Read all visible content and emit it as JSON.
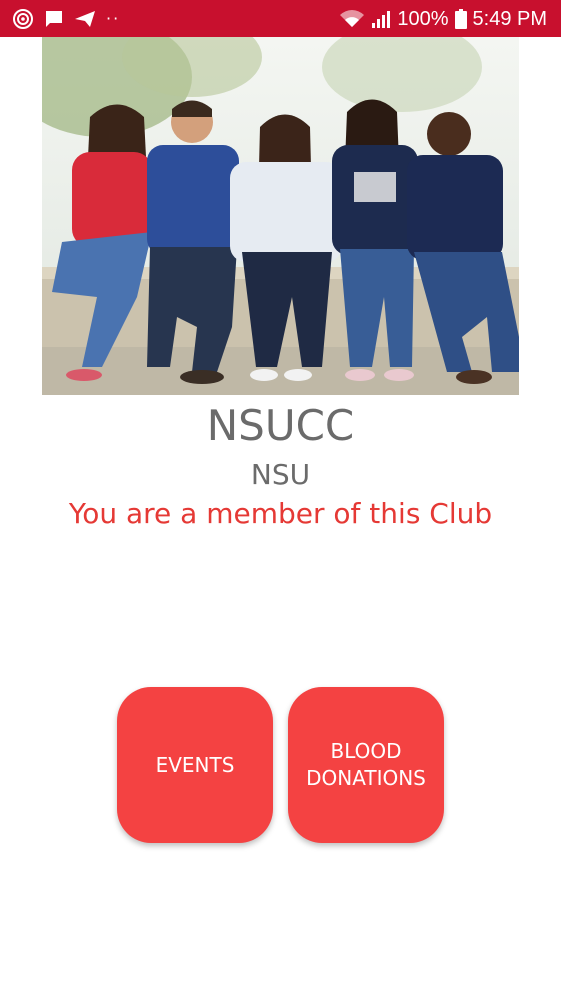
{
  "status_bar": {
    "battery": "100%",
    "time": "5:49 PM",
    "background": "#c8102e",
    "icons": [
      "app-swirl-icon",
      "message-icon",
      "send-icon",
      "more-dots-icon",
      "wifi-icon",
      "signal-icon",
      "battery-icon"
    ]
  },
  "hero": {
    "image": "group-of-young-people-sitting-on-wall"
  },
  "club": {
    "name": "NSUCC",
    "organization": "NSU",
    "membership_status": "You are a member of this Club"
  },
  "actions": {
    "events_label": "EVENTS",
    "blood_donations_label": "BLOOD\nDONATIONS",
    "button_color": "#f44242"
  },
  "colors": {
    "accent_red": "#e53935",
    "text_gray": "#6b6b6b"
  }
}
